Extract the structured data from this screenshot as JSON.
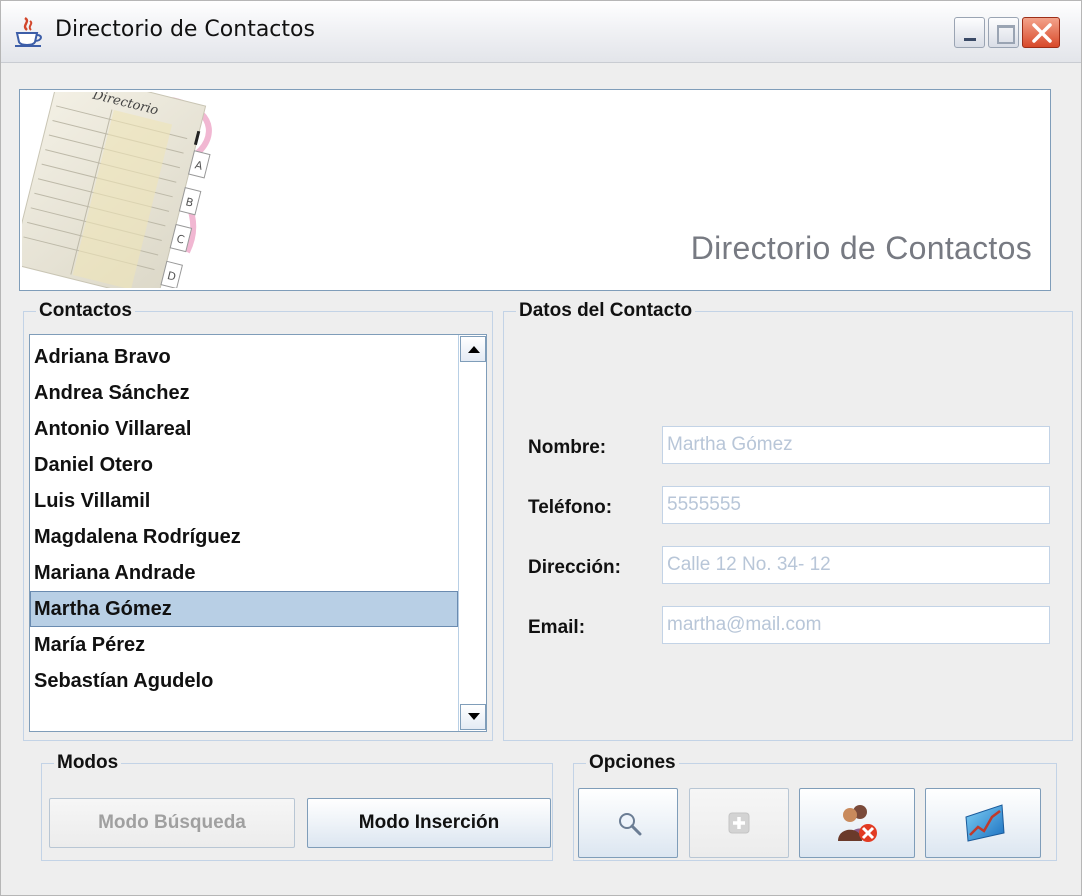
{
  "window": {
    "title": "Directorio de Contactos"
  },
  "banner": {
    "title": "Directorio de Contactos",
    "graphic_text": "Directorio",
    "tab_letters": [
      "A",
      "B",
      "C",
      "D"
    ]
  },
  "contactos": {
    "title": "Contactos",
    "items": [
      "Adriana Bravo",
      "Andrea Sánchez",
      "Antonio Villareal",
      "Daniel Otero",
      "Luis Villamil",
      "Magdalena Rodríguez",
      "Mariana Andrade",
      "Martha Gómez",
      "María Pérez",
      "Sebastían Agudelo"
    ],
    "selected": "Martha Gómez"
  },
  "datos": {
    "title": "Datos del Contacto",
    "nombre_label": "Nombre:",
    "nombre_value": "Martha Gómez",
    "telefono_label": "Teléfono:",
    "telefono_value": "5555555",
    "direccion_label": "Dirección:",
    "direccion_value": "Calle 12 No. 34- 12",
    "email_label": "Email:",
    "email_value": "martha@mail.com"
  },
  "modos": {
    "title": "Modos",
    "busqueda_label": "Modo Búsqueda",
    "insercion_label": "Modo Inserción"
  },
  "opciones": {
    "title": "Opciones",
    "icons": [
      "search-icon",
      "add-icon",
      "delete-contact-icon",
      "chart-icon"
    ]
  },
  "colors": {
    "selection": "#b8cfe5",
    "border": "#7f9db9",
    "close_button": "#d8492a"
  }
}
